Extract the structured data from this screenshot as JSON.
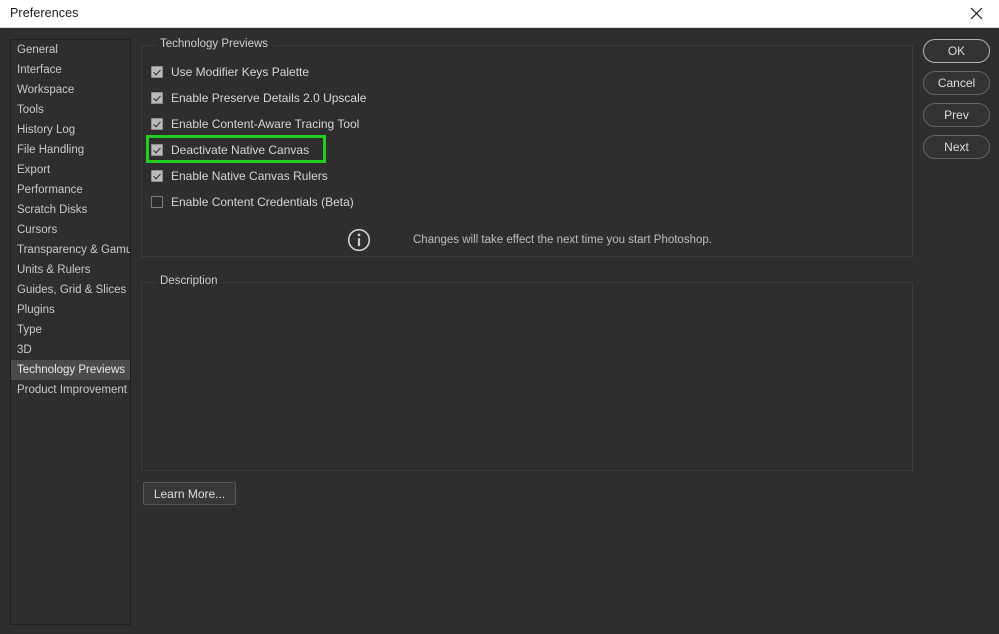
{
  "window": {
    "title": "Preferences",
    "close_icon": "close-icon"
  },
  "sidebar": {
    "items": [
      {
        "label": "General",
        "selected": false
      },
      {
        "label": "Interface",
        "selected": false
      },
      {
        "label": "Workspace",
        "selected": false
      },
      {
        "label": "Tools",
        "selected": false
      },
      {
        "label": "History Log",
        "selected": false
      },
      {
        "label": "File Handling",
        "selected": false
      },
      {
        "label": "Export",
        "selected": false
      },
      {
        "label": "Performance",
        "selected": false
      },
      {
        "label": "Scratch Disks",
        "selected": false
      },
      {
        "label": "Cursors",
        "selected": false
      },
      {
        "label": "Transparency & Gamut",
        "selected": false
      },
      {
        "label": "Units & Rulers",
        "selected": false
      },
      {
        "label": "Guides, Grid & Slices",
        "selected": false
      },
      {
        "label": "Plugins",
        "selected": false
      },
      {
        "label": "Type",
        "selected": false
      },
      {
        "label": "3D",
        "selected": false
      },
      {
        "label": "Technology Previews",
        "selected": true
      },
      {
        "label": "Product Improvement",
        "selected": false
      }
    ]
  },
  "tech_group": {
    "title": "Technology Previews",
    "options": [
      {
        "label": "Use Modifier Keys Palette",
        "checked": true,
        "highlighted": false
      },
      {
        "label": "Enable Preserve Details 2.0 Upscale",
        "checked": true,
        "highlighted": false
      },
      {
        "label": "Enable Content-Aware Tracing Tool",
        "checked": true,
        "highlighted": false
      },
      {
        "label": "Deactivate Native Canvas",
        "checked": true,
        "highlighted": true
      },
      {
        "label": "Enable Native Canvas Rulers",
        "checked": true,
        "highlighted": false
      },
      {
        "label": "Enable Content Credentials (Beta)",
        "checked": false,
        "highlighted": false
      }
    ],
    "note": {
      "icon": "info-icon",
      "text": "Changes will take effect the next time you start Photoshop."
    }
  },
  "description_group": {
    "title": "Description",
    "body": ""
  },
  "learn_more": {
    "label": "Learn More..."
  },
  "buttons": [
    {
      "label": "OK",
      "primary": true
    },
    {
      "label": "Cancel",
      "primary": false
    },
    {
      "label": "Prev",
      "primary": false
    },
    {
      "label": "Next",
      "primary": false
    }
  ],
  "colors": {
    "dialog_bg": "#2e2e2e",
    "titlebar_bg": "#ffffff",
    "highlight_green": "#22cc22",
    "selected_item_bg": "#4b4b4b"
  }
}
